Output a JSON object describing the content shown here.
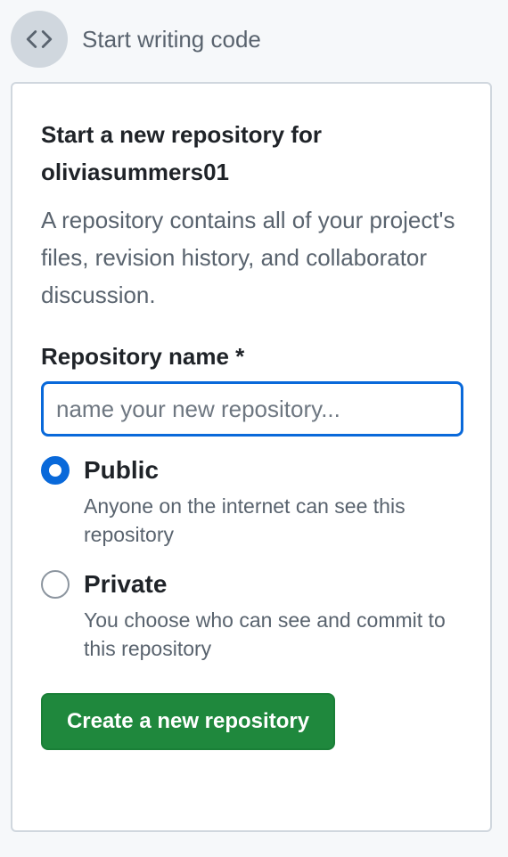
{
  "header": {
    "icon": "code-icon",
    "title": "Start writing code"
  },
  "card": {
    "title": "Start a new repository for oliviasummers01",
    "description": "A repository contains all of your project's files, revision history, and collaborator discussion.",
    "repo_name_label": "Repository name *",
    "repo_name_placeholder": "name your new repository...",
    "repo_name_value": "",
    "visibility_options": [
      {
        "label": "Public",
        "description": "Anyone on the internet can see this repository",
        "checked": true
      },
      {
        "label": "Private",
        "description": "You choose who can see and commit to this repository",
        "checked": false
      }
    ],
    "create_button_label": "Create a new repository"
  },
  "colors": {
    "accent_blue": "#0969da",
    "primary_green": "#1f883d",
    "muted_text": "#59636e",
    "border": "#d0d7de"
  }
}
